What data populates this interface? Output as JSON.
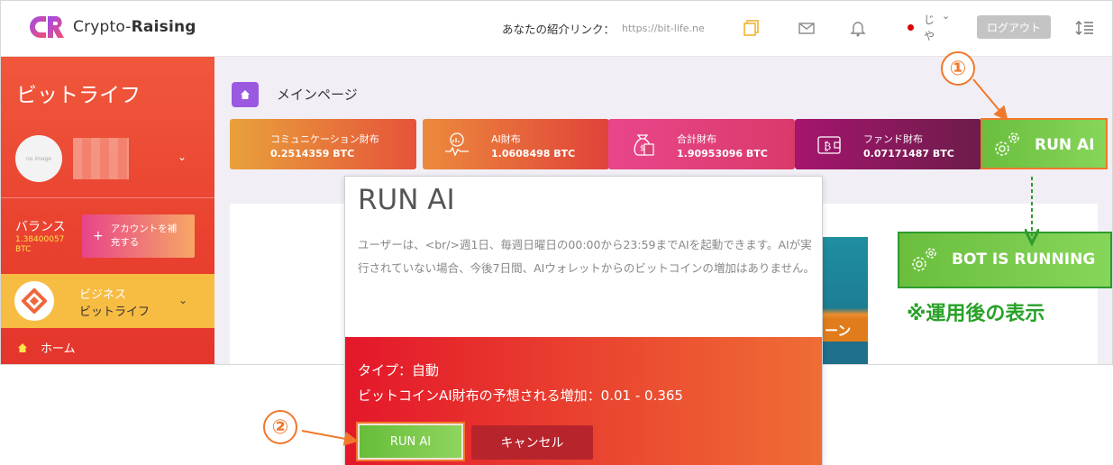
{
  "header": {
    "brand_pre": "Crypto-",
    "brand_bold": "Raising",
    "referral_label": "あなたの紹介リンク：",
    "referral_url": "https://bit-life.ne",
    "lang_line1": "じ",
    "lang_line2": "や",
    "logout_label": "ログアウト"
  },
  "sidebar": {
    "title": "ビットライフ",
    "avatar_text": "no image",
    "balance_label": "バランス",
    "balance_value": "1.38400057 BTC",
    "account_button": "アカウントを補充する",
    "business_line1": "ビジネス",
    "business_line2": "ビットライフ",
    "home_label": "ホーム"
  },
  "main": {
    "title": "メインページ",
    "cards": [
      {
        "name": "コミュニケーション財布",
        "value": "0.2514359 BTC",
        "color": "#e9a13b"
      },
      {
        "name": "AI財布",
        "value": "1.0608498 BTC",
        "color": "#ec8a3c"
      },
      {
        "name": "合計財布",
        "value": "1.90953096 BTC",
        "color": "#e64e93"
      },
      {
        "name": "ファンド財布",
        "value": "0.07171487 BTC",
        "color": "#a5156e"
      }
    ],
    "run_ai_label": "RUN AI",
    "promo_text": "ーン"
  },
  "annotations": {
    "badge1": "①",
    "badge2": "②",
    "bot_running": "BOT IS RUNNING",
    "note": "※運用後の表示"
  },
  "modal": {
    "title": "RUN AI",
    "description": "ユーザーは、<br/>週1日、毎週日曜日の00:00から23:59までAIを起動できます。AIが実行されていない場合、今後7日間、AIウォレットからのビットコインの増加はありません。",
    "type_line": "タイプ：自動",
    "expected_line": "ビットコインAI財布の予想される増加：0.01 - 0.365",
    "run_button": "RUN AI",
    "cancel_button": "キャンセル"
  },
  "colors": {
    "sidebar": "#ea4530",
    "accent_orange": "#f0782c",
    "run_green": "#6bbe3d",
    "note_green": "#28a128"
  }
}
